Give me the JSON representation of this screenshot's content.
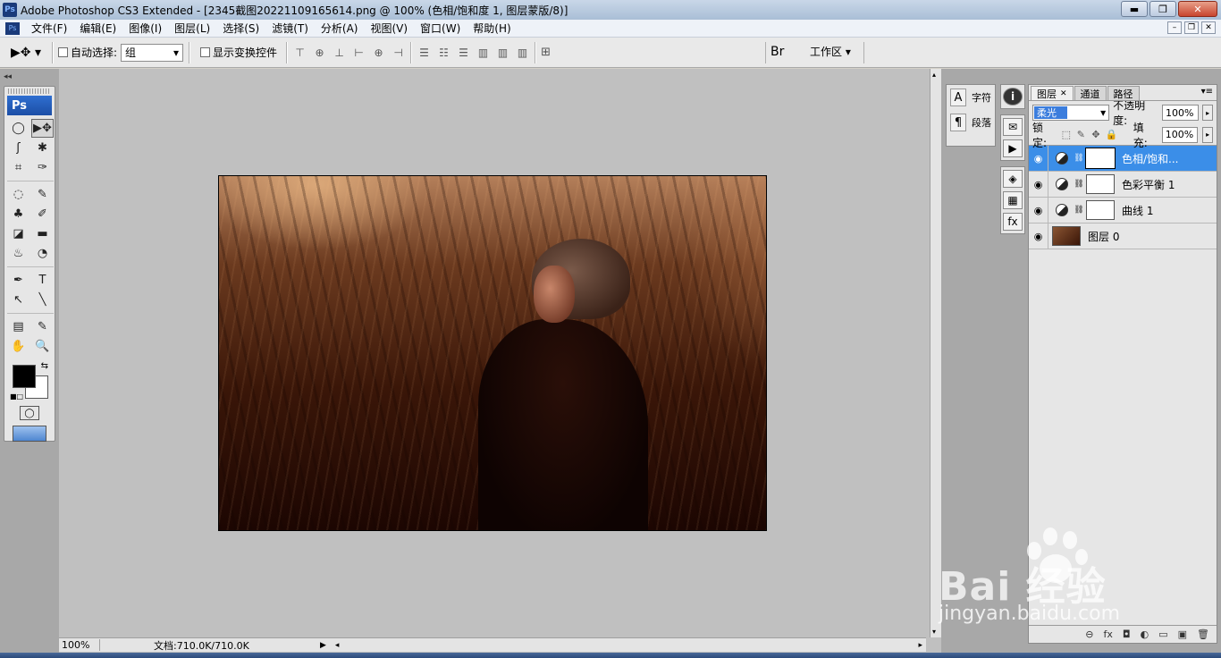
{
  "window": {
    "title": "Adobe Photoshop CS3 Extended - [2345截图20221109165614.png @ 100% (色相/饱和度 1, 图层蒙版/8)]",
    "app_icon": "Ps",
    "buttons": {
      "minimize": "▬",
      "maximize": "❐",
      "close": "✕"
    }
  },
  "menu": {
    "items": [
      "文件(F)",
      "编辑(E)",
      "图像(I)",
      "图层(L)",
      "选择(S)",
      "滤镜(T)",
      "分析(A)",
      "视图(V)",
      "窗口(W)",
      "帮助(H)"
    ],
    "doc_buttons": {
      "minimize": "–",
      "restore": "❐",
      "close": "✕"
    }
  },
  "options": {
    "tool_preset": "▶✥ ▾",
    "auto_select_label": "自动选择:",
    "auto_select_value": "组",
    "show_transform_label": "显示变换控件",
    "align_icons": [
      "⊤",
      "⊕",
      "⊥",
      "⊢",
      "⊕",
      "⊣"
    ],
    "distribute_icons": [
      "☰",
      "☷",
      "☰",
      "▥",
      "▥",
      "▥"
    ],
    "auto_align_icon": "⊞",
    "bridge_icon": "Br",
    "workspace_label": "工作区 ▾"
  },
  "toolbox": {
    "logo": "Ps",
    "tools": [
      "◯",
      "▶✥",
      "ʃ",
      "✱",
      "⌗",
      "✑",
      "◌",
      "✎",
      "♣",
      "✐",
      "◪",
      "▬",
      "♨",
      "◔",
      "✒",
      "T",
      "↖",
      "╲",
      "▤",
      "✎",
      "✋",
      "🔍"
    ],
    "active_index": 1,
    "swap": "⇆",
    "default": "■□",
    "quick_mask": "◯"
  },
  "status": {
    "zoom": "100%",
    "doc_info": "文档:710.0K/710.0K",
    "arrow": "▶",
    "scroll_left": "◂",
    "scroll_right": "▸"
  },
  "character_panel": {
    "items": [
      {
        "icon": "A",
        "label": "字符"
      },
      {
        "icon": "¶",
        "label": "段落"
      }
    ]
  },
  "dock_icons": {
    "group1": [
      "i"
    ],
    "group2": [
      "✉",
      "▶"
    ],
    "group3": [
      "◈",
      "▦",
      "fx"
    ]
  },
  "layers_panel": {
    "tabs": [
      "图层",
      "通道",
      "路径"
    ],
    "active_tab": 0,
    "tab_close": "✕",
    "blend_mode": "柔光",
    "opacity_label": "不透明度:",
    "opacity_value": "100%",
    "lock_label": "锁定:",
    "lock_icons": [
      "⬚",
      "✎",
      "✥",
      "🔒"
    ],
    "fill_label": "填充:",
    "fill_value": "100%",
    "layers": [
      {
        "name": "色相/饱和...",
        "type": "adjustment",
        "selected": true,
        "visible": true
      },
      {
        "name": "色彩平衡 1",
        "type": "adjustment",
        "selected": false,
        "visible": true
      },
      {
        "name": "曲线 1",
        "type": "adjustment",
        "selected": false,
        "visible": true
      },
      {
        "name": "图层 0",
        "type": "image",
        "selected": false,
        "visible": true
      }
    ],
    "footer_icons": [
      "⊖",
      "fx",
      "◘",
      "◐",
      "▭",
      "▣",
      "🗑"
    ]
  },
  "watermark": {
    "brand": "Bai  经验",
    "url": "jingyan.baidu.com"
  },
  "colors": {
    "accent": "#3b8ee8",
    "workspace_bg": "#c0c0c0",
    "panel_bg": "#e6e6e6"
  }
}
